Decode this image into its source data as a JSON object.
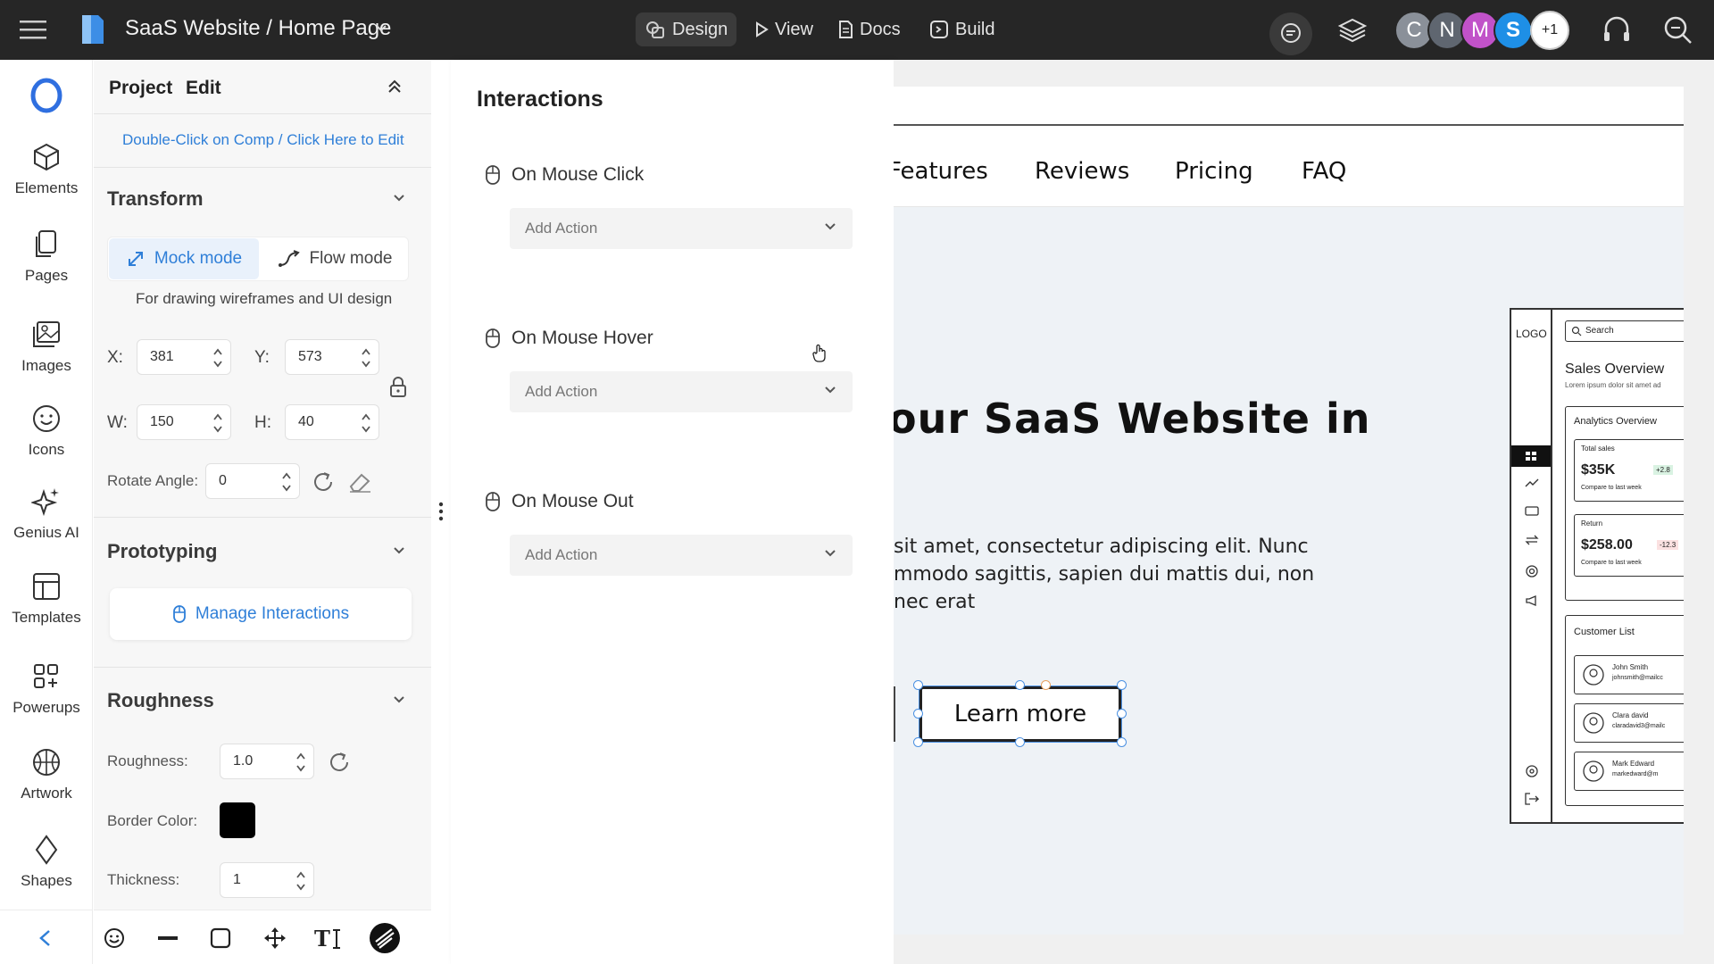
{
  "topbar": {
    "project_title": "SaaS Website / Home Page",
    "tabs": [
      {
        "label": "Design",
        "icon": "shapes-icon",
        "active": true
      },
      {
        "label": "View",
        "icon": "play-icon"
      },
      {
        "label": "Docs",
        "icon": "document-icon"
      },
      {
        "label": "Build",
        "icon": "code-icon"
      }
    ],
    "avatars": [
      {
        "initial": "C",
        "color": "#8a9099"
      },
      {
        "initial": "N",
        "color": "#5f6670"
      },
      {
        "initial": "M",
        "color": "#c152c9"
      },
      {
        "initial": "S",
        "color": "#1e8fe6"
      }
    ],
    "more_count": "+1"
  },
  "rail": {
    "items": [
      {
        "label": "Elements",
        "icon": "cube-icon"
      },
      {
        "label": "Pages",
        "icon": "pages-icon"
      },
      {
        "label": "Images",
        "icon": "images-icon"
      },
      {
        "label": "Icons",
        "icon": "smiley-icon"
      },
      {
        "label": "Genius AI",
        "icon": "sparkle-icon"
      },
      {
        "label": "Templates",
        "icon": "templates-icon"
      },
      {
        "label": "Powerups",
        "icon": "powerups-icon"
      },
      {
        "label": "Artwork",
        "icon": "basketball-icon"
      },
      {
        "label": "Shapes",
        "icon": "diamond-icon"
      }
    ]
  },
  "props": {
    "tab_project": "Project",
    "tab_edit": "Edit",
    "hint_link": "Double-Click on Comp / Click Here to Edit",
    "transform_title": "Transform",
    "mock_mode": "Mock mode",
    "flow_mode": "Flow mode",
    "mode_desc": "For drawing wireframes and UI design",
    "x_label": "X:",
    "x_value": "381",
    "y_label": "Y:",
    "y_value": "573",
    "w_label": "W:",
    "w_value": "150",
    "h_label": "H:",
    "h_value": "40",
    "rotate_label": "Rotate Angle:",
    "rotate_value": "0",
    "prototyping_title": "Prototyping",
    "manage_interactions": "Manage Interactions",
    "roughness_title": "Roughness",
    "roughness_label": "Roughness:",
    "roughness_value": "1.0",
    "border_color_label": "Border Color:",
    "border_color": "#000000",
    "thickness_label": "Thickness:",
    "thickness_value": "1"
  },
  "interactions": {
    "title": "Interactions",
    "events": [
      {
        "label": "On Mouse Click",
        "action_placeholder": "Add Action"
      },
      {
        "label": "On Mouse Hover",
        "action_placeholder": "Add Action"
      },
      {
        "label": "On Mouse Out",
        "action_placeholder": "Add Action"
      }
    ]
  },
  "canvas": {
    "nav_links": [
      "Features",
      "Reviews",
      "Pricing",
      "FAQ"
    ],
    "hero_text": "our SaaS Website in",
    "paragraph_lines": [
      "sit amet, consectetur adipiscing elit. Nunc",
      "mmodo sagittis, sapien dui mattis dui, non",
      "nec erat"
    ],
    "cta_label": "Learn more",
    "mockup": {
      "logo": "LOGO",
      "search": "Search",
      "title": "Sales Overview",
      "subtitle": "Lorem ipsum dolor sit amet ad",
      "analytics_title": "Analytics Overview",
      "cards": [
        {
          "label": "Total sales",
          "value": "$35K",
          "badge": "+2.8",
          "note": "Compare to last week"
        },
        {
          "label": "Return",
          "value": "$258.00",
          "badge": "-12.3",
          "note": "Compare to last week"
        }
      ],
      "customer_list_title": "Customer List",
      "customers": [
        {
          "name": "John Smith",
          "email": "johnsmith@mailcc"
        },
        {
          "name": "Clara david",
          "email": "claradavid3@mailc"
        },
        {
          "name": "Mark Edward",
          "email": "markedward@m"
        }
      ]
    }
  },
  "colors": {
    "accent": "#2f7fd8",
    "topbar": "#262626",
    "selection": "#4a90e2"
  }
}
